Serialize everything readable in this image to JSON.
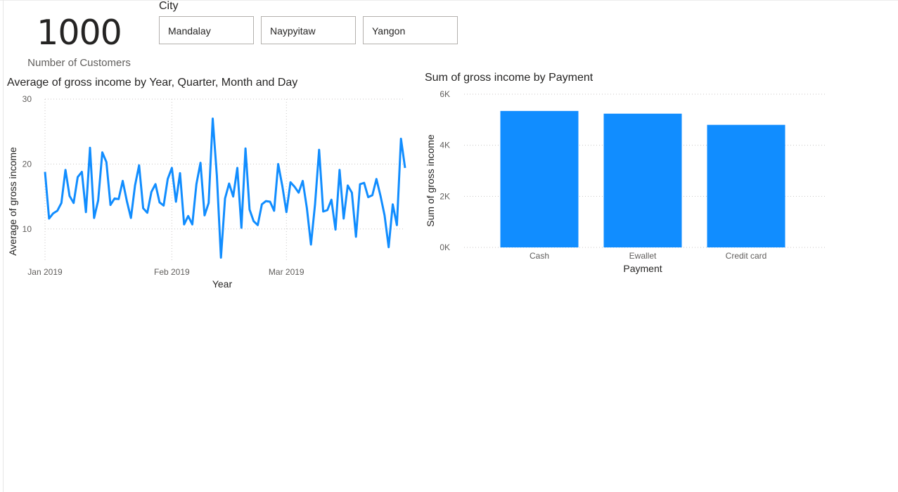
{
  "kpi": {
    "value": "1000",
    "label": "Number of Customers"
  },
  "slicer": {
    "title": "City",
    "options": [
      "Mandalay",
      "Naypyitaw",
      "Yangon"
    ]
  },
  "colors": {
    "series": "#118DFF",
    "grid": "#c8c6c4"
  },
  "line_chart": {
    "title": "Average of gross income by Year, Quarter, Month and Day"
  },
  "bar_chart": {
    "title": "Sum of gross income by Payment"
  },
  "chart_data": [
    {
      "type": "line",
      "title": "Average of gross income by Year, Quarter, Month and Day",
      "xlabel": "Year",
      "ylabel": "Average of gross income",
      "ylim": [
        5,
        30
      ],
      "y_ticks": [
        10,
        20,
        30
      ],
      "x_tick_labels": [
        "Jan 2019",
        "Feb 2019",
        "Mar 2019"
      ],
      "xlim": [
        "2019-01-01",
        "2019-03-30"
      ],
      "grid": true,
      "series": [
        {
          "x": [
            "2019-01-01",
            "2019-01-02",
            "2019-01-03",
            "2019-01-04",
            "2019-01-05",
            "2019-01-06",
            "2019-01-07",
            "2019-01-08",
            "2019-01-09",
            "2019-01-10",
            "2019-01-11",
            "2019-01-12",
            "2019-01-13",
            "2019-01-14",
            "2019-01-15",
            "2019-01-16",
            "2019-01-17",
            "2019-01-18",
            "2019-01-19",
            "2019-01-20",
            "2019-01-21",
            "2019-01-22",
            "2019-01-23",
            "2019-01-24",
            "2019-01-25",
            "2019-01-26",
            "2019-01-27",
            "2019-01-28",
            "2019-01-29",
            "2019-01-30",
            "2019-01-31",
            "2019-02-01",
            "2019-02-02",
            "2019-02-03",
            "2019-02-04",
            "2019-02-05",
            "2019-02-06",
            "2019-02-07",
            "2019-02-08",
            "2019-02-09",
            "2019-02-10",
            "2019-02-11",
            "2019-02-12",
            "2019-02-13",
            "2019-02-14",
            "2019-02-15",
            "2019-02-16",
            "2019-02-17",
            "2019-02-18",
            "2019-02-19",
            "2019-02-20",
            "2019-02-21",
            "2019-02-22",
            "2019-02-23",
            "2019-02-24",
            "2019-02-25",
            "2019-02-26",
            "2019-02-27",
            "2019-02-28",
            "2019-03-01",
            "2019-03-02",
            "2019-03-03",
            "2019-03-04",
            "2019-03-05",
            "2019-03-06",
            "2019-03-07",
            "2019-03-08",
            "2019-03-09",
            "2019-03-10",
            "2019-03-11",
            "2019-03-12",
            "2019-03-13",
            "2019-03-14",
            "2019-03-15",
            "2019-03-16",
            "2019-03-17",
            "2019-03-18",
            "2019-03-19",
            "2019-03-20",
            "2019-03-21",
            "2019-03-22",
            "2019-03-23",
            "2019-03-24",
            "2019-03-25",
            "2019-03-26",
            "2019-03-27",
            "2019-03-28",
            "2019-03-29",
            "2019-03-30"
          ],
          "y": [
            18.8,
            11.6,
            12.4,
            12.8,
            14.0,
            19.1,
            15.1,
            14.0,
            18.0,
            18.8,
            12.6,
            22.5,
            11.7,
            14.4,
            21.8,
            20.3,
            13.7,
            14.7,
            14.6,
            17.4,
            14.3,
            11.7,
            16.7,
            19.8,
            13.2,
            12.5,
            15.7,
            16.9,
            14.1,
            13.6,
            17.7,
            19.4,
            14.2,
            18.6,
            10.7,
            12.0,
            10.7,
            16.9,
            20.2,
            12.1,
            14.0,
            27.0,
            18.2,
            5.6,
            14.7,
            17.0,
            15.0,
            19.4,
            10.2,
            22.4,
            13.0,
            11.2,
            10.6,
            13.8,
            14.3,
            14.2,
            12.8,
            20.0,
            16.6,
            12.6,
            17.2,
            16.5,
            15.6,
            17.4,
            13.2,
            7.6,
            13.8,
            22.2,
            12.7,
            12.9,
            14.5,
            9.9,
            19.1,
            11.6,
            16.7,
            15.6,
            8.8,
            16.9,
            17.1,
            14.9,
            15.2,
            17.7,
            15.1,
            12.1,
            7.2,
            13.8,
            10.6,
            23.9,
            19.4
          ]
        }
      ]
    },
    {
      "type": "bar",
      "title": "Sum of gross income by Payment",
      "xlabel": "Payment",
      "ylabel": "Sum of gross income",
      "categories": [
        "Cash",
        "Ewallet",
        "Credit card"
      ],
      "values": [
        5343,
        5237,
        4799
      ],
      "ylim": [
        0,
        6000
      ],
      "y_ticks": [
        0,
        2000,
        4000,
        6000
      ],
      "y_tick_labels": [
        "0K",
        "2K",
        "4K",
        "6K"
      ],
      "grid": true
    }
  ]
}
